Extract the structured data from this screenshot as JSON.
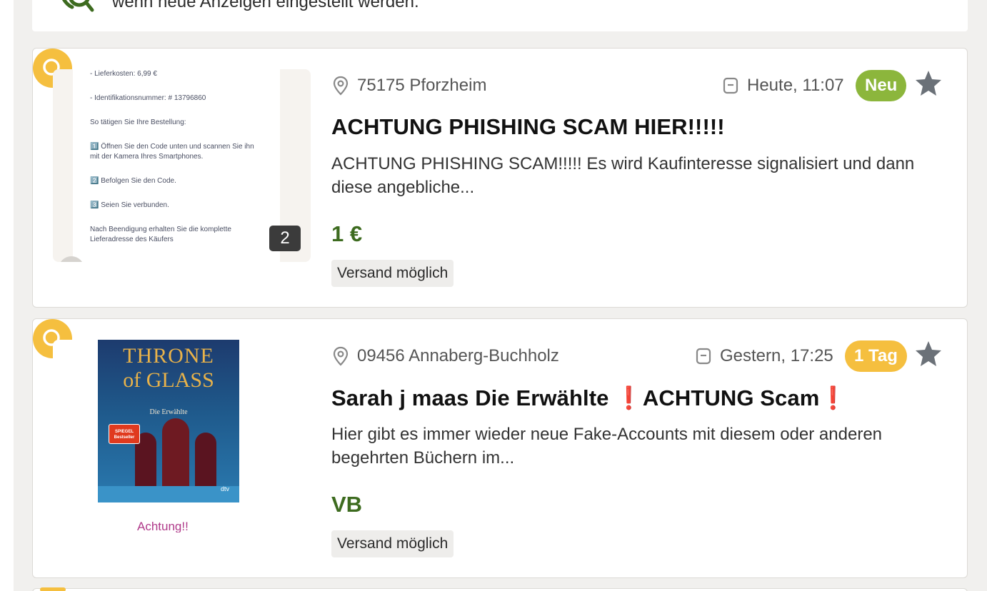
{
  "banner": {
    "text": "wenn neue Anzeigen eingestellt werden."
  },
  "listings": [
    {
      "location": "75175 Pforzheim",
      "date": "Heute, 11:07",
      "tag": "Neu",
      "title": "ACHTUNG PHISHING SCAM HIER!!!!!",
      "description": "ACHTUNG PHISHING SCAM!!!!! Es wird Kaufinteresse signalisiert und dann diese angebliche...",
      "price": "1 €",
      "shipping": "Versand möglich",
      "image_count": "2",
      "thumbnail_text": [
        "- Lieferkosten: 6,99 €",
        "- Identifikationsnummer: # 13796860",
        "So tätigen Sie Ihre Bestellung:",
        "1️⃣ Öffnen Sie den Code unten und scannen Sie ihn mit der Kamera Ihres Smartphones.",
        "2️⃣ Befolgen Sie den Code.",
        "3️⃣ Seien Sie verbunden.",
        "Nach Beendigung erhalten Sie die komplette Lieferadresse des Käufers"
      ]
    },
    {
      "location": "09456 Annaberg-Buchholz",
      "date": "Gestern, 17:25",
      "tag": "1 Tag",
      "title_part1": "Sarah j maas Die Erwählte ",
      "title_warn1": "❗",
      "title_part2": "ACHTUNG Scam",
      "title_warn2": "❗",
      "description": "Hier gibt es immer wieder neue Fake-Accounts mit diesem oder anderen begehrten Büchern im...",
      "price": "VB",
      "shipping": "Versand möglich",
      "book_title_line1": "THRONE",
      "book_title_line2": "of GLASS",
      "book_subtitle": "Die Erwählte",
      "book_sticker": "SPIEGEL Bestseller",
      "book_publisher": "dtv",
      "thumbnail_caption": "Achtung!!"
    }
  ],
  "colors": {
    "badge_yellow": "#f5bf3f",
    "new_green": "#8cb63c",
    "price_green": "#3d6b1f",
    "page_bg": "#f1f0ee"
  }
}
